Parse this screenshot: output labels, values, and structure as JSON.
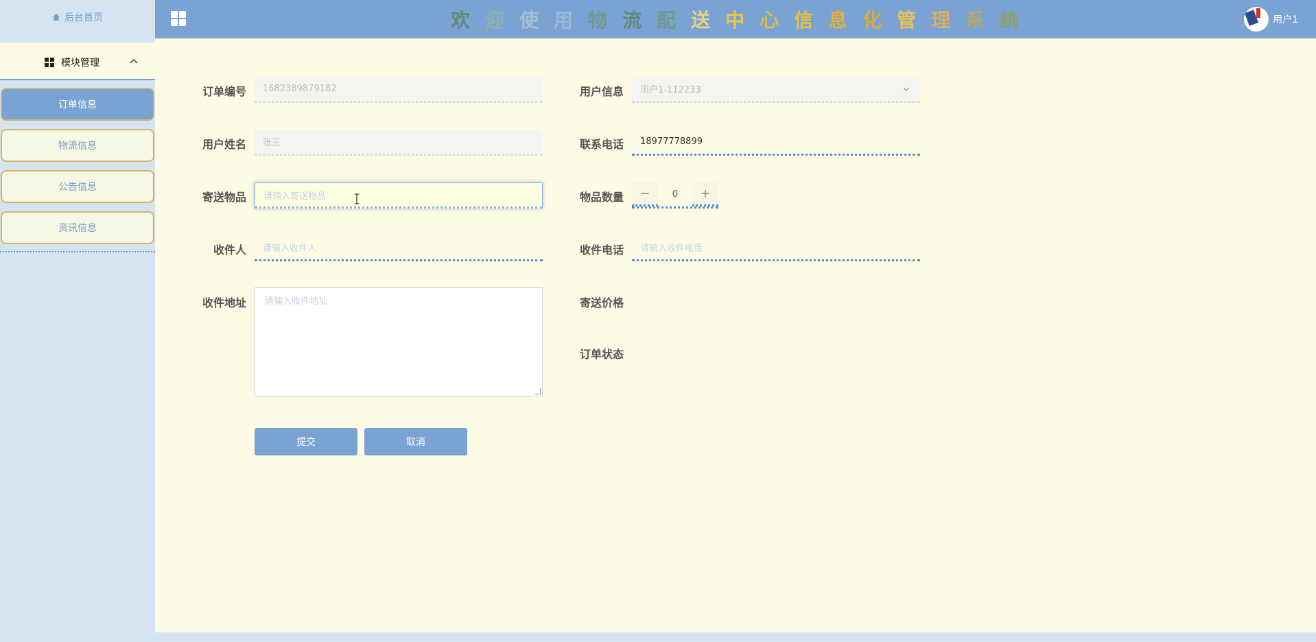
{
  "sidebar": {
    "home_label": "后台首页",
    "module_title": "模块管理",
    "items": [
      {
        "label": "订单信息",
        "active": true
      },
      {
        "label": "物流信息",
        "active": false
      },
      {
        "label": "公告信息",
        "active": false
      },
      {
        "label": "资讯信息",
        "active": false
      }
    ]
  },
  "header": {
    "welcome_chars": [
      {
        "ch": "欢",
        "color": "#5f8a78"
      },
      {
        "ch": "迎",
        "color": "#8fb1a8"
      },
      {
        "ch": "使",
        "color": "#a9bfcf"
      },
      {
        "ch": "用",
        "color": "#9ab8d8"
      },
      {
        "ch": "物",
        "color": "#6f9a8a"
      },
      {
        "ch": "流",
        "color": "#5f8a78"
      },
      {
        "ch": "配",
        "color": "#6f9a8a"
      },
      {
        "ch": "送",
        "color": "#e8d088"
      },
      {
        "ch": "中",
        "color": "#f0c646"
      },
      {
        "ch": "心",
        "color": "#e0b848"
      },
      {
        "ch": "信",
        "color": "#e8c040"
      },
      {
        "ch": "息",
        "color": "#e2b23a"
      },
      {
        "ch": "化",
        "color": "#d8ae3a"
      },
      {
        "ch": "管",
        "color": "#e6c25a"
      },
      {
        "ch": "理",
        "color": "#d6b060"
      },
      {
        "ch": "系",
        "color": "#b8a66a"
      },
      {
        "ch": "统",
        "color": "#8f9e6a"
      }
    ],
    "user_name": "用户1"
  },
  "form": {
    "order_no": {
      "label": "订单编号",
      "value": "1682389879182"
    },
    "user_info": {
      "label": "用户信息",
      "value": "用户1-112233"
    },
    "user_name": {
      "label": "用户姓名",
      "value": "张三"
    },
    "phone": {
      "label": "联系电话",
      "value": "18977778899"
    },
    "item": {
      "label": "寄送物品",
      "placeholder": "请输入寄送物品"
    },
    "quantity": {
      "label": "物品数量",
      "value": "0"
    },
    "receiver": {
      "label": "收件人",
      "placeholder": "请输入收件人"
    },
    "receiver_phone": {
      "label": "收件电话",
      "placeholder": "请输入收件电话"
    },
    "address": {
      "label": "收件地址",
      "placeholder": "请输入收件地址"
    },
    "price": {
      "label": "寄送价格"
    },
    "status": {
      "label": "订单状态"
    },
    "submit_label": "提交",
    "cancel_label": "取消"
  }
}
